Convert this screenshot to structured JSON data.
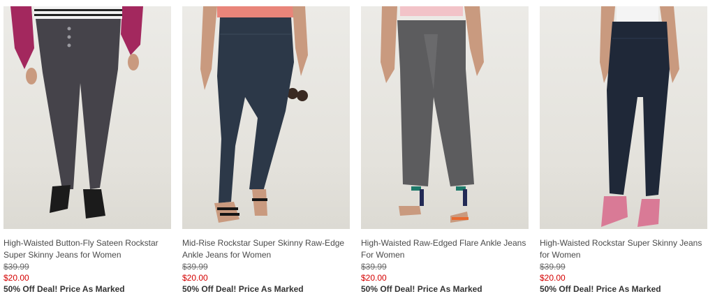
{
  "products": [
    {
      "name_line1": "High-Waisted Button-Fly Sateen Rockstar",
      "name_line2": "Super Skinny Jeans for Women",
      "original_price": "$39.99",
      "sale_price": "$20.00",
      "deal": "50% Off Deal! Price As Marked",
      "image": "model-wearing-dark-gray-button-fly-skinny-jeans"
    },
    {
      "name_line1": "Mid-Rise Rockstar Super Skinny Raw-Edge",
      "name_line2": "Ankle Jeans for Women",
      "original_price": "$39.99",
      "sale_price": "$20.00",
      "deal": "50% Off Deal! Price As Marked",
      "image": "model-wearing-dark-wash-raw-edge-ankle-jeans"
    },
    {
      "name_line1": "High-Waisted Raw-Edged Flare Ankle Jeans",
      "name_line2": "For Women",
      "original_price": "$39.99",
      "sale_price": "$20.00",
      "deal": "50% Off Deal! Price As Marked",
      "image": "model-wearing-gray-flare-ankle-jeans"
    },
    {
      "name_line1": "High-Waisted Rockstar Super Skinny Jeans",
      "name_line2": "for Women",
      "original_price": "$39.99",
      "sale_price": "$20.00",
      "deal": "50% Off Deal! Price As Marked",
      "image": "model-wearing-indigo-super-skinny-jeans"
    }
  ],
  "colors": {
    "sale_price": "#d40000",
    "original_price": "#6b6b6b",
    "text": "#4a4a4a"
  }
}
